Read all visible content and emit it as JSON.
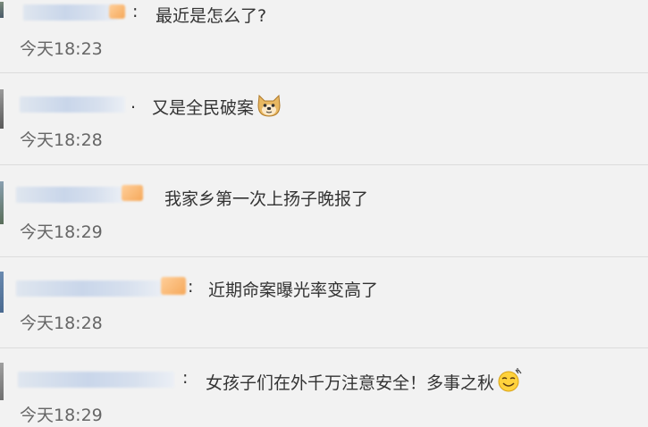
{
  "comments": [
    {
      "separator": ":",
      "text": "最近是怎么了?",
      "time": "今天18:23"
    },
    {
      "separator": ".",
      "text": "又是全民破案",
      "emoji": "doge-emoji",
      "time": "今天18:28"
    },
    {
      "separator": "",
      "text": "我家乡第一次上扬子晚报了",
      "time": "今天18:29"
    },
    {
      "separator": ":",
      "text": "近期命案曝光率变高了",
      "time": "今天18:28"
    },
    {
      "separator": ":",
      "text": "女孩子们在外千万注意安全！多事之秋",
      "emoji": "sweat-smile-emoji",
      "time": "今天18:29"
    }
  ]
}
